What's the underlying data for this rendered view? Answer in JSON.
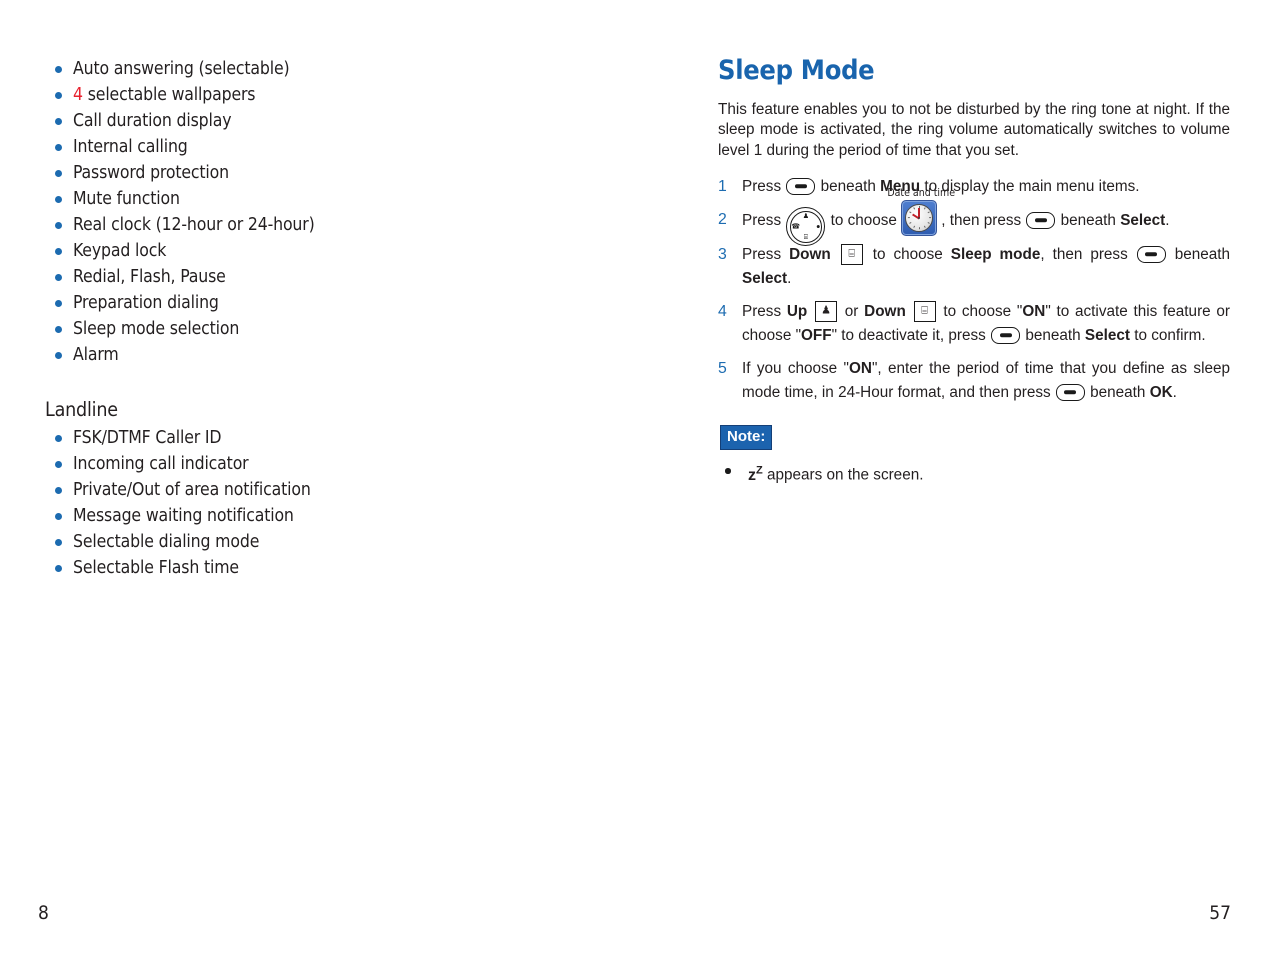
{
  "left_page": {
    "page_number": "8",
    "features": [
      {
        "text": "Auto answering (selectable)"
      },
      {
        "text": "selectable wallpapers",
        "lead_number": "4",
        "lead_color": "#e8212e"
      },
      {
        "text": "Call duration display"
      },
      {
        "text": "Internal calling"
      },
      {
        "text": "Password protection"
      },
      {
        "text": "Mute function"
      },
      {
        "text": "Real clock (12-hour or 24-hour)"
      },
      {
        "text": "Keypad lock"
      },
      {
        "text": "Redial, Flash, Pause"
      },
      {
        "text": "Preparation dialing"
      },
      {
        "text": "Sleep mode selection"
      },
      {
        "text": "Alarm"
      }
    ],
    "landline": {
      "heading": "Landline",
      "features": [
        "FSK/DTMF Caller ID",
        "Incoming call indicator",
        "Private/Out of area notification",
        "Message waiting notification",
        "Selectable dialing mode",
        "Selectable Flash time"
      ]
    }
  },
  "right_page": {
    "page_number": "57",
    "title": "Sleep Mode",
    "intro": "This feature enables you to not be disturbed by the ring tone at night. If the sleep mode is activated, the ring volume automatically switches to volume level 1 during the period of time that you set.",
    "steps": [
      {
        "number": "1",
        "parts": [
          {
            "t": "text",
            "v": "Press "
          },
          {
            "t": "icon",
            "v": "softkey-icon"
          },
          {
            "t": "text",
            "v": " beneath "
          },
          {
            "t": "bold",
            "v": "Menu"
          },
          {
            "t": "text",
            "v": " to display the main menu items."
          }
        ]
      },
      {
        "number": "2",
        "parts": [
          {
            "t": "text",
            "v": "Press "
          },
          {
            "t": "icon",
            "v": "navigation-wheel-icon"
          },
          {
            "t": "text",
            "v": " to choose "
          },
          {
            "t": "icon",
            "v": "date-and-time-menu-icon",
            "caption": "Date and time"
          },
          {
            "t": "text",
            "v": ", then press "
          },
          {
            "t": "icon",
            "v": "softkey-icon"
          },
          {
            "t": "text",
            "v": " beneath "
          },
          {
            "t": "bold",
            "v": "Select"
          },
          {
            "t": "text",
            "v": "."
          }
        ]
      },
      {
        "number": "3",
        "parts": [
          {
            "t": "text",
            "v": "Press "
          },
          {
            "t": "bold",
            "v": "Down"
          },
          {
            "t": "text",
            "v": " "
          },
          {
            "t": "icon",
            "v": "down-key-icon"
          },
          {
            "t": "text",
            "v": " to choose "
          },
          {
            "t": "bold",
            "v": "Sleep mode"
          },
          {
            "t": "text",
            "v": ", then press "
          },
          {
            "t": "icon",
            "v": "softkey-icon"
          },
          {
            "t": "text",
            "v": " beneath "
          },
          {
            "t": "bold",
            "v": "Select"
          },
          {
            "t": "text",
            "v": "."
          }
        ]
      },
      {
        "number": "4",
        "parts": [
          {
            "t": "text",
            "v": "Press "
          },
          {
            "t": "bold",
            "v": "Up"
          },
          {
            "t": "text",
            "v": " "
          },
          {
            "t": "icon",
            "v": "up-key-icon"
          },
          {
            "t": "text",
            "v": " or "
          },
          {
            "t": "bold",
            "v": "Down"
          },
          {
            "t": "text",
            "v": " "
          },
          {
            "t": "icon",
            "v": "down-key-icon"
          },
          {
            "t": "text",
            "v": " to choose \""
          },
          {
            "t": "bold",
            "v": "ON"
          },
          {
            "t": "text",
            "v": "\" to activate this feature or choose \""
          },
          {
            "t": "bold",
            "v": "OFF"
          },
          {
            "t": "text",
            "v": "\" to deactivate it, press "
          },
          {
            "t": "icon",
            "v": "softkey-icon"
          },
          {
            "t": "text",
            "v": " beneath "
          },
          {
            "t": "bold",
            "v": "Select"
          },
          {
            "t": "text",
            "v": " to confirm."
          }
        ]
      },
      {
        "number": "5",
        "parts": [
          {
            "t": "text",
            "v": "If you choose \""
          },
          {
            "t": "bold",
            "v": "ON"
          },
          {
            "t": "text",
            "v": "\", enter the period of time that you define as sleep mode time, in 24-Hour format, and then press "
          },
          {
            "t": "icon",
            "v": "softkey-icon"
          },
          {
            "t": "text",
            "v": " beneath "
          },
          {
            "t": "bold",
            "v": "OK"
          },
          {
            "t": "text",
            "v": "."
          }
        ]
      }
    ],
    "note": {
      "label": "Note:",
      "items": [
        {
          "prefix_symbol": "z",
          "superscript": "Z",
          "text": " appears on the screen."
        }
      ]
    }
  },
  "colors": {
    "heading_blue": "#1964ad",
    "bullet_blue": "#1c6bb0",
    "step_number_blue": "#1d6cb1",
    "note_badge_blue": "#1c63ae",
    "accent_red": "#e8212e",
    "body_text": "#231f20"
  }
}
